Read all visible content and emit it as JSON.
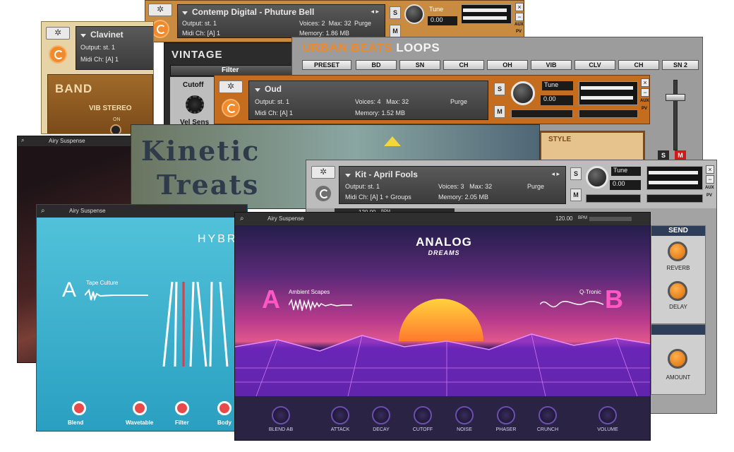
{
  "common": {
    "gear": "✲",
    "s": "S",
    "m": "M",
    "close": "×",
    "minus": "−",
    "aux": "AUX",
    "pv": "PV",
    "purge": "Purge",
    "tune": "Tune",
    "tune_value": "0.00",
    "output_label": "Output:",
    "midi_label": "Midi Ch:",
    "voices_label": "Voices:",
    "max_label": "Max:",
    "memory_label": "Memory:",
    "nav": "◂ ▸"
  },
  "contemp": {
    "title": "Contemp Digital - Phuture Bell",
    "output": "st. 1",
    "voices": "2",
    "max": "32",
    "midi": "[A]  1",
    "memory": "1.86 MB"
  },
  "clavinet": {
    "title": "Clavinet",
    "output": "st. 1",
    "midi": "[A]  1",
    "band_label": "BAND",
    "vib": "VIB STEREO",
    "on": "ON"
  },
  "vintage": {
    "title": "VINTAGE",
    "filter": "Filter",
    "cutoff": "Cutoff",
    "vel_sens": "Vel Sens"
  },
  "urban": {
    "title_a": "URBAN BEATS",
    "title_b": "LOOPS",
    "pads": [
      "PRESET",
      "BD",
      "SN",
      "CH",
      "OH",
      "VIB",
      "CLV",
      "CH",
      "SN 2"
    ],
    "style": "STYLE"
  },
  "oud": {
    "title": "Oud",
    "output": "st. 1",
    "voices": "4",
    "max": "32",
    "midi": "[A]  1",
    "memory": "1.52 MB"
  },
  "kinetic": {
    "line1": "Kinetic",
    "line2": "Treats"
  },
  "airy_back": {
    "preset": "Airy Suspense"
  },
  "kit": {
    "title": "Kit - April Fools",
    "output": "st. 1",
    "voices": "3",
    "max": "32",
    "midi": "[A]  1 + Groups",
    "memory": "2.05 MB",
    "bpm": "120.00",
    "bpm_unit": "BPM",
    "send": "SEND",
    "reverb": "REVERB",
    "delay": "DELAY",
    "amount": "AMOUNT"
  },
  "hybrid": {
    "preset": "Airy Suspense",
    "title": "HYBR",
    "letter": "A",
    "sample": "Tape Culture",
    "knobs": [
      "Blend",
      "Wavetable",
      "Filter",
      "Body"
    ]
  },
  "analog": {
    "preset": "Airy Suspense",
    "bpm": "120.00",
    "bpm_unit": "BPM",
    "logo_top": "ANALOG",
    "logo_bottom": "DREAMS",
    "slot_a_letter": "A",
    "slot_a_name": "Ambient Scapes",
    "slot_b_letter": "B",
    "slot_b_name": "Q-Tronic",
    "knobs": [
      "BLEND AB",
      "ATTACK",
      "DECAY",
      "CUTOFF",
      "NOISE",
      "PHASER",
      "CRUNCH",
      "VOLUME"
    ]
  }
}
